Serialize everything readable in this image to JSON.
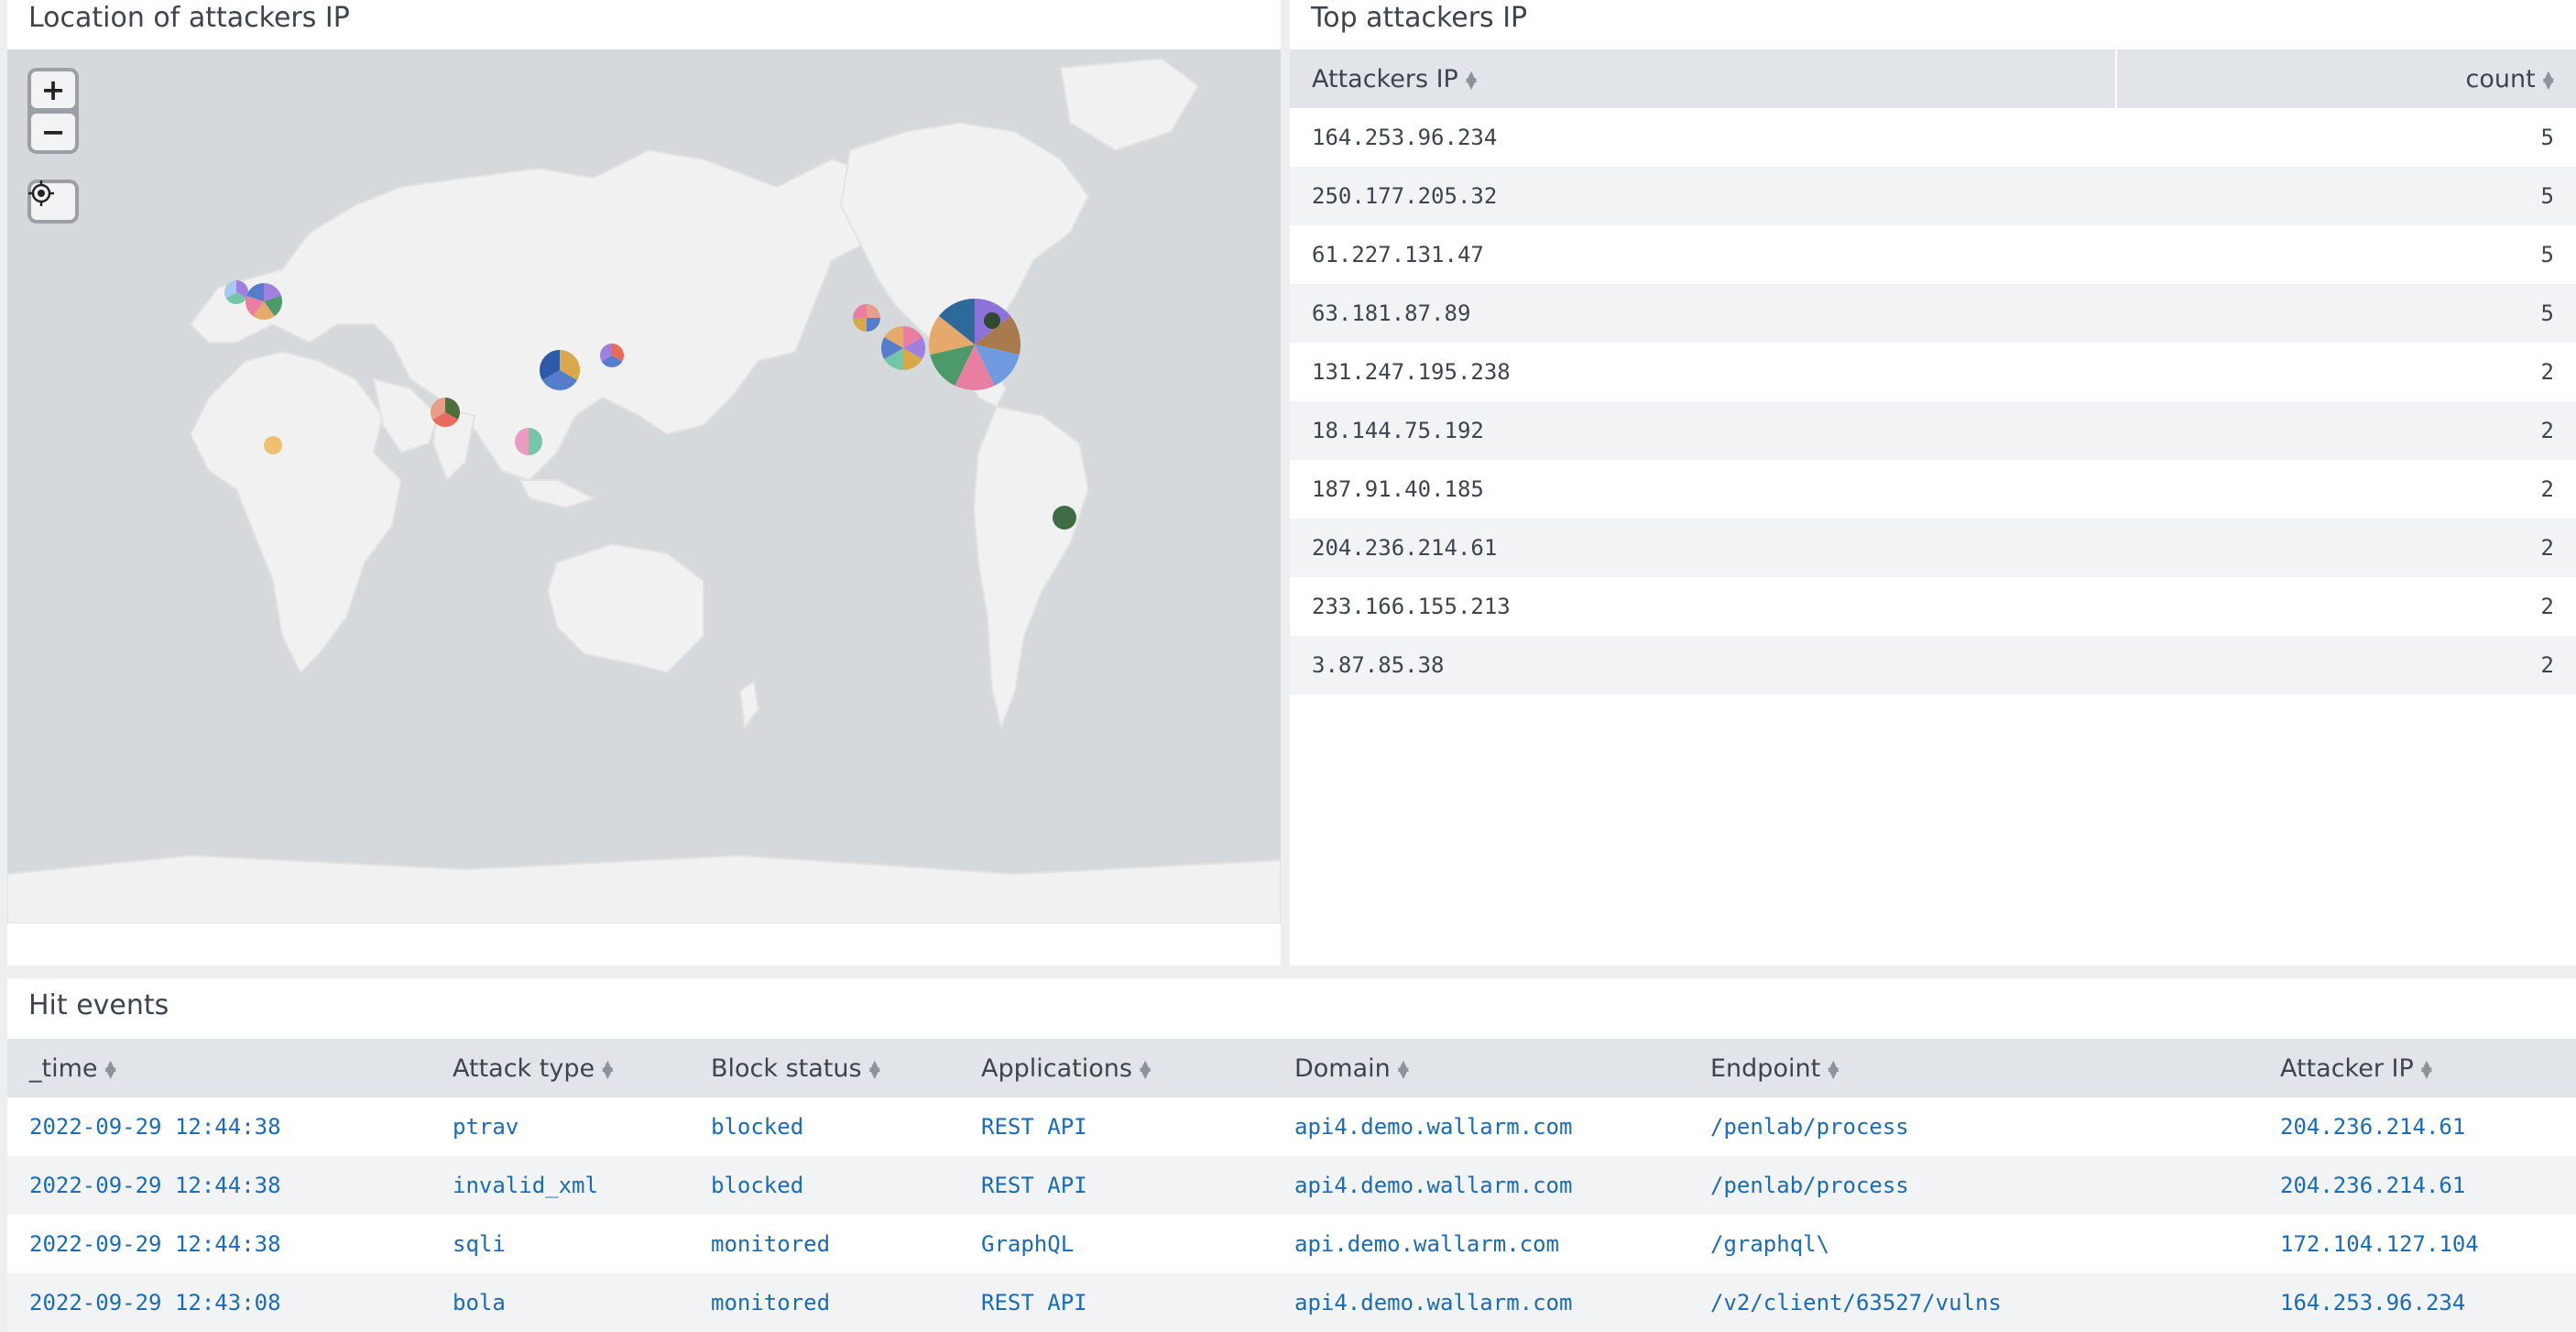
{
  "map_panel": {
    "title": "Location of attackers IP",
    "controls": {
      "zoom_in": "+",
      "zoom_out": "−"
    },
    "markers": [
      {
        "region": "United Kingdom",
        "colors": [
          "#9f7fe0",
          "#73c6a8",
          "#a9c8f0"
        ]
      },
      {
        "region": "Western Europe",
        "colors": [
          "#9f7fe0",
          "#4c9a6a",
          "#e6a96b",
          "#e87ea0",
          "#567dcc"
        ]
      },
      {
        "region": "West Africa",
        "colors": [
          "#f0c070"
        ]
      },
      {
        "region": "India",
        "colors": [
          "#4c6e3c",
          "#e86b5c",
          "#e89c8a"
        ]
      },
      {
        "region": "Singapore",
        "colors": [
          "#73c6a8",
          "#e89cc0"
        ]
      },
      {
        "region": "China",
        "colors": [
          "#d9a84a",
          "#567dcc",
          "#2d5aa8"
        ]
      },
      {
        "region": "Japan",
        "colors": [
          "#e86b5c",
          "#567dcc",
          "#9f7fe0"
        ]
      },
      {
        "region": "US West",
        "colors": [
          "#e89c8a",
          "#567dcc",
          "#d9a84a",
          "#e87ea0"
        ]
      },
      {
        "region": "US California",
        "colors": [
          "#e87ea0",
          "#9f7fe0",
          "#d9a84a",
          "#73c6a8",
          "#567dcc",
          "#e6a96b"
        ]
      },
      {
        "region": "US East",
        "colors": [
          "#8e72dc",
          "#a87a4c",
          "#6f9ae0",
          "#e87ea0",
          "#4c9a6a",
          "#e6a96b",
          "#2d6a9a"
        ]
      },
      {
        "region": "Brazil",
        "colors": [
          "#3f6b45"
        ]
      }
    ]
  },
  "top_attackers": {
    "title": "Top attackers IP",
    "columns": [
      "Attackers IP",
      "count"
    ],
    "rows": [
      {
        "ip": "164.253.96.234",
        "count": "5"
      },
      {
        "ip": "250.177.205.32",
        "count": "5"
      },
      {
        "ip": "61.227.131.47",
        "count": "5"
      },
      {
        "ip": "63.181.87.89",
        "count": "5"
      },
      {
        "ip": "131.247.195.238",
        "count": "2"
      },
      {
        "ip": "18.144.75.192",
        "count": "2"
      },
      {
        "ip": "187.91.40.185",
        "count": "2"
      },
      {
        "ip": "204.236.214.61",
        "count": "2"
      },
      {
        "ip": "233.166.155.213",
        "count": "2"
      },
      {
        "ip": "3.87.85.38",
        "count": "2"
      }
    ]
  },
  "hit_events": {
    "title": "Hit events",
    "columns": [
      "_time",
      "Attack type",
      "Block status",
      "Applications",
      "Domain",
      "Endpoint",
      "Attacker IP"
    ],
    "rows": [
      [
        "2022-09-29 12:44:38",
        "ptrav",
        "blocked",
        "REST API",
        "api4.demo.wallarm.com",
        "/penlab/process",
        "204.236.214.61"
      ],
      [
        "2022-09-29 12:44:38",
        "invalid_xml",
        "blocked",
        "REST API",
        "api4.demo.wallarm.com",
        "/penlab/process",
        "204.236.214.61"
      ],
      [
        "2022-09-29 12:44:38",
        "sqli",
        "monitored",
        "GraphQL",
        "api.demo.wallarm.com",
        "/graphql\\",
        "172.104.127.104"
      ],
      [
        "2022-09-29 12:43:08",
        "bola",
        "monitored",
        "REST API",
        "api4.demo.wallarm.com",
        "/v2/client/63527/vulns",
        "164.253.96.234"
      ]
    ]
  },
  "colors": {
    "header_bg": "#e1e5e9",
    "link": "#1a6bb8",
    "map_bg": "#d6d9dc",
    "land": "#f1f1f1"
  }
}
